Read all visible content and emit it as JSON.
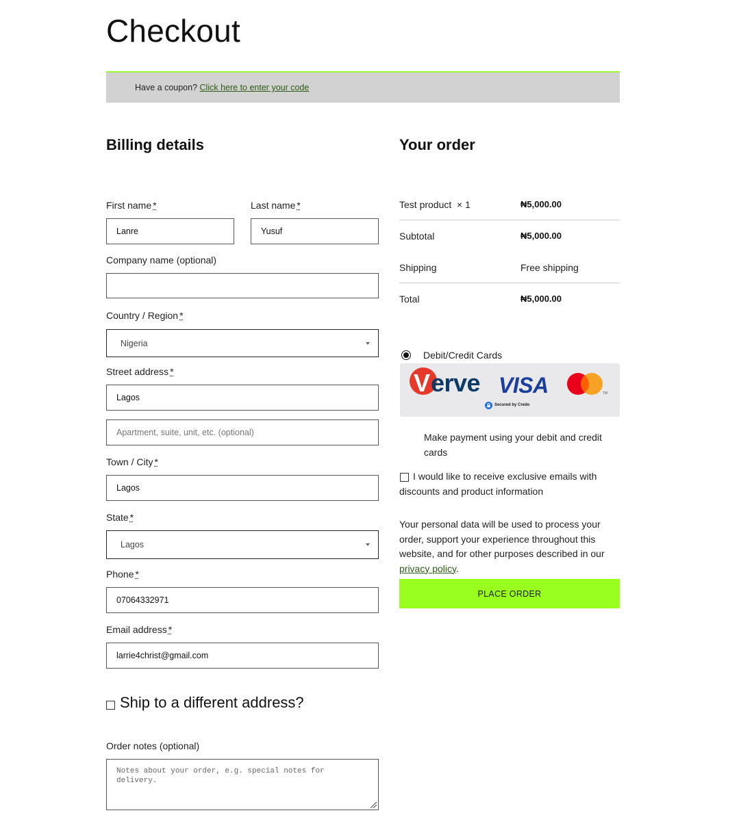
{
  "page": {
    "title": "Checkout"
  },
  "coupon": {
    "prompt": "Have a coupon?",
    "link": "Click here to enter your code"
  },
  "billing": {
    "heading": "Billing details",
    "first_name": {
      "label": "First name",
      "value": "Lanre"
    },
    "last_name": {
      "label": "Last name",
      "value": "Yusuf"
    },
    "company": {
      "label": "Company name (optional)",
      "value": ""
    },
    "country": {
      "label": "Country / Region",
      "value": "Nigeria"
    },
    "street": {
      "label": "Street address",
      "value": "Lagos",
      "placeholder2": "Apartment, suite, unit, etc. (optional)"
    },
    "city": {
      "label": "Town / City",
      "value": "Lagos"
    },
    "state": {
      "label": "State",
      "value": "Lagos"
    },
    "phone": {
      "label": "Phone",
      "value": "07064332971"
    },
    "email": {
      "label": "Email address",
      "value": "larrie4christ@gmail.com"
    },
    "required_mark": "*"
  },
  "shipping": {
    "label": "Ship to a different address?"
  },
  "notes": {
    "label": "Order notes (optional)",
    "placeholder": "Notes about your order, e.g. special notes for delivery."
  },
  "order": {
    "heading": "Your order",
    "product": {
      "name": "Test product",
      "qty": "× 1",
      "price": "₦5,000.00"
    },
    "subtotal": {
      "label": "Subtotal",
      "value": "₦5,000.00"
    },
    "shipping": {
      "label": "Shipping",
      "value": "Free shipping"
    },
    "total": {
      "label": "Total",
      "value": "₦5,000.00"
    }
  },
  "payment": {
    "method_label": "Debit/Credit Cards",
    "brands": {
      "verve_v": "V",
      "verve_rest": "erve",
      "visa": "VISA",
      "mastercard_tm": "TM",
      "secured_by": "Secured by Credo"
    },
    "description": "Make payment using your debit and credit cards",
    "colors": {
      "verve_red": "#e53a2b",
      "verve_navy": "#0d3b66",
      "visa_blue": "#1a3e9c",
      "mc_red": "#eb001b",
      "mc_orange": "#f79e1b",
      "credo_blue": "#1f6feb"
    }
  },
  "newsletter": {
    "label": "I would like to receive exclusive emails with discounts and product information"
  },
  "privacy": {
    "text_before": "Your personal data will be used to process your order, support your experience throughout this website, and for other purposes described in our ",
    "link": "privacy policy",
    "text_after": "."
  },
  "place_order": {
    "label": "PLACE ORDER"
  },
  "theme": {
    "accent": "#99ff1f",
    "link": "#2d5a14",
    "coupon_bg": "#d2d2d2"
  }
}
